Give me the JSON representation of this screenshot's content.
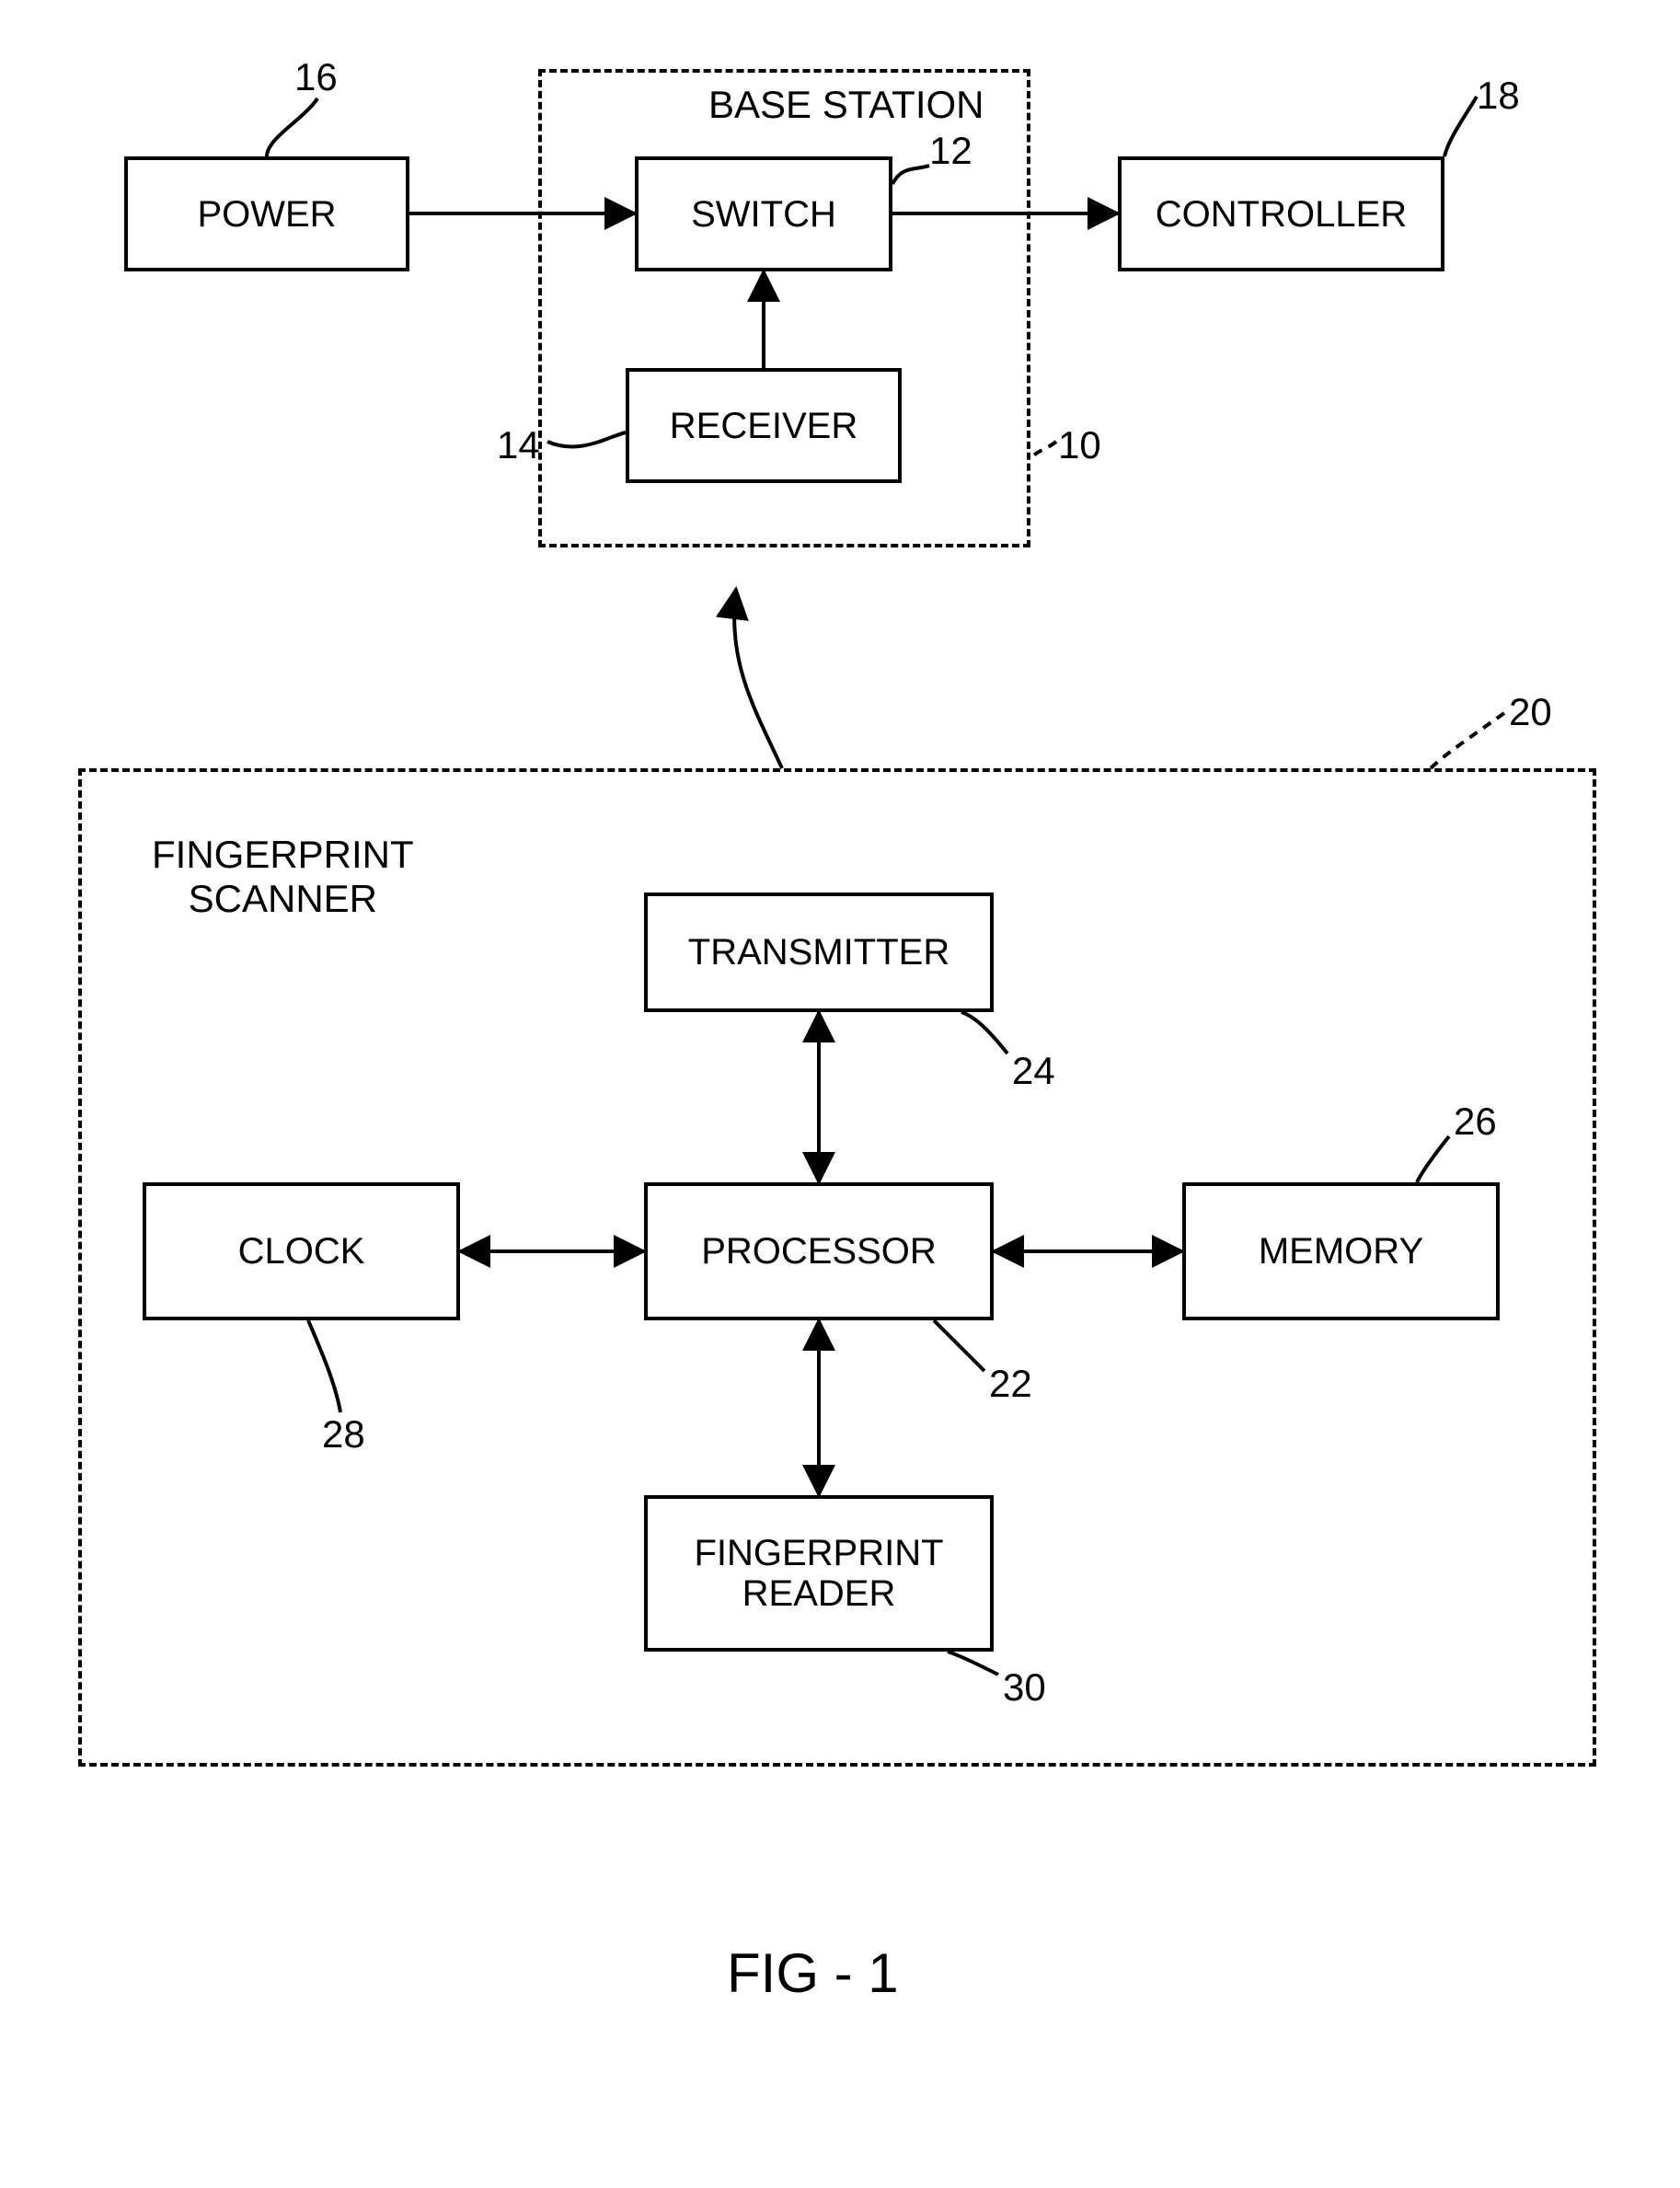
{
  "figure_label": "FIG - 1",
  "base_station": {
    "group_label": "BASE STATION",
    "ref": "10",
    "switch": {
      "label": "SWITCH",
      "ref": "12"
    },
    "receiver": {
      "label": "RECEIVER",
      "ref": "14"
    }
  },
  "power": {
    "label": "POWER",
    "ref": "16"
  },
  "controller": {
    "label": "CONTROLLER",
    "ref": "18"
  },
  "scanner": {
    "group_label": "FINGERPRINT\nSCANNER",
    "ref": "20",
    "processor": {
      "label": "PROCESSOR",
      "ref": "22"
    },
    "transmitter": {
      "label": "TRANSMITTER",
      "ref": "24"
    },
    "memory": {
      "label": "MEMORY",
      "ref": "26"
    },
    "clock": {
      "label": "CLOCK",
      "ref": "28"
    },
    "reader": {
      "label": "FINGERPRINT\nREADER",
      "ref": "30"
    }
  }
}
